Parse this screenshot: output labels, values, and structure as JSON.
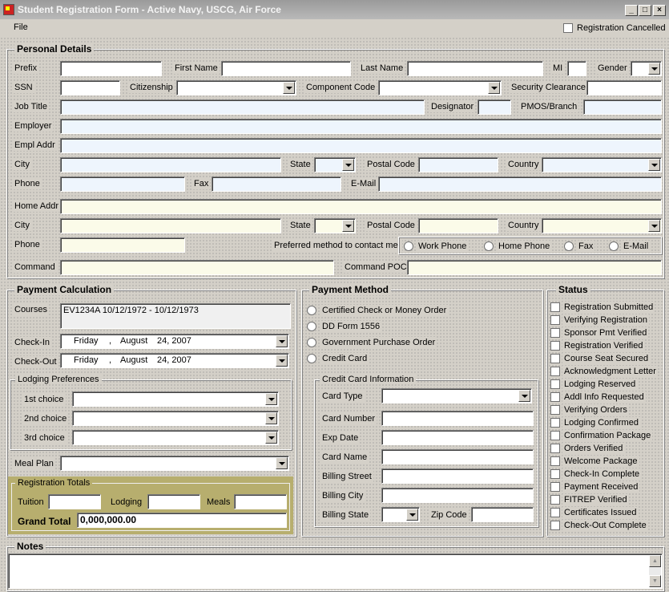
{
  "window": {
    "title": "Student Registration Form - Active Navy, USCG, Air Force"
  },
  "menu": {
    "file": "File"
  },
  "header": {
    "registration_cancelled": "Registration Cancelled"
  },
  "personal": {
    "title": "Personal Details",
    "prefix": "Prefix",
    "first_name": "First Name",
    "last_name": "Last Name",
    "mi": "MI",
    "gender": "Gender",
    "ssn": "SSN",
    "citizenship": "Citizenship",
    "component_code": "Component Code",
    "security_clearance": "Security Clearance",
    "job_title": "Job Title",
    "designator": "Designator",
    "pmos": "PMOS/Branch",
    "employer": "Employer",
    "empl_addr": "Empl Addr",
    "city": "City",
    "state": "State",
    "postal_code": "Postal Code",
    "country": "Country",
    "phone": "Phone",
    "fax": "Fax",
    "email": "E-Mail",
    "home_addr": "Home Addr",
    "city2": "City",
    "state2": "State",
    "postal_code2": "Postal Code",
    "country2": "Country",
    "phone2": "Phone",
    "preferred": "Preferred method to contact me:",
    "contact_options": [
      "Work Phone",
      "Home Phone",
      "Fax",
      "E-Mail"
    ],
    "command": "Command",
    "command_poc": "Command POC"
  },
  "payment_calc": {
    "title": "Payment Calculation",
    "courses": "Courses",
    "course_value": "EV1234A   10/12/1972 - 10/12/1973",
    "check_in": "Check-In",
    "check_in_value": {
      "day": "Friday",
      "sep": ",",
      "month": "August",
      "date": "24, 2007"
    },
    "check_out": "Check-Out",
    "check_out_value": {
      "day": "Friday",
      "sep": ",",
      "month": "August",
      "date": "24, 2007"
    },
    "lodging_title": "Lodging Preferences",
    "choices": [
      "1st choice",
      "2nd choice",
      "3rd choice"
    ],
    "meal_plan": "Meal Plan"
  },
  "totals": {
    "title": "Registration Totals",
    "tuition": "Tuition",
    "lodging": "Lodging",
    "meals": "Meals",
    "grand_total": "Grand Total",
    "grand_total_value": "0,000,000.00"
  },
  "payment_method": {
    "title": "Payment Method",
    "options": [
      "Certified Check or Money Order",
      "DD Form 1556",
      "Government Purchase Order",
      "Credit Card"
    ],
    "cc_title": "Credit Card Information",
    "card_type": "Card Type",
    "card_number": "Card Number",
    "exp_date": "Exp Date",
    "card_name": "Card Name",
    "billing_street": "Billing Street",
    "billing_city": "Billing City",
    "billing_state": "Billing State",
    "zip": "Zip Code"
  },
  "status": {
    "title": "Status",
    "items": [
      "Registration Submitted",
      "Verifying Registration",
      "Sponsor Pmt Verified",
      "Registration Verified",
      "Course Seat Secured",
      "Acknowledgment Letter",
      "Lodging Reserved",
      "Addl Info Requested",
      "Verifying Orders",
      "Lodging Confirmed",
      "Confirmation Package",
      "Orders Verified",
      "Welcome Package",
      "Check-In Complete",
      "Payment Received",
      "FITREP Verified",
      "Certificates Issued",
      "Check-Out Complete"
    ]
  },
  "notes": {
    "title": "Notes"
  },
  "colors": {
    "field_blue": "#eef5fd",
    "field_cream": "#fbfbe9",
    "totals_bg": "#b7ae6e"
  }
}
